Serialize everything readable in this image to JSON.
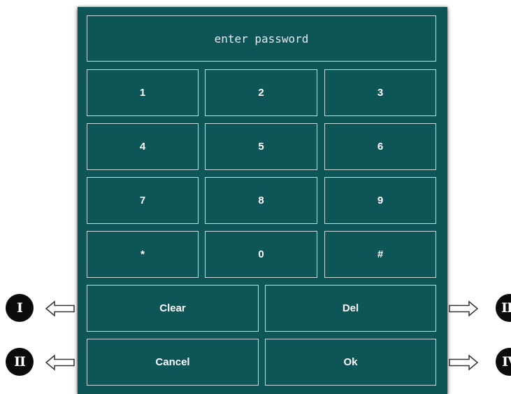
{
  "keypad": {
    "password_placeholder": "enter password",
    "keys": {
      "k1": "1",
      "k2": "2",
      "k3": "3",
      "k4": "4",
      "k5": "5",
      "k6": "6",
      "k7": "7",
      "k8": "8",
      "k9": "9",
      "star": "*",
      "k0": "0",
      "hash": "#"
    },
    "clear_label": "Clear",
    "del_label": "Del",
    "cancel_label": "Cancel",
    "ok_label": "Ok"
  },
  "annotations": {
    "badge_1": "I",
    "badge_2": "II",
    "badge_3": "III",
    "badge_4": "IV"
  },
  "colors": {
    "panel_bg": "#0e5558",
    "key_border": "#c6d8d8",
    "badge_bg": "#0b0b0b"
  }
}
